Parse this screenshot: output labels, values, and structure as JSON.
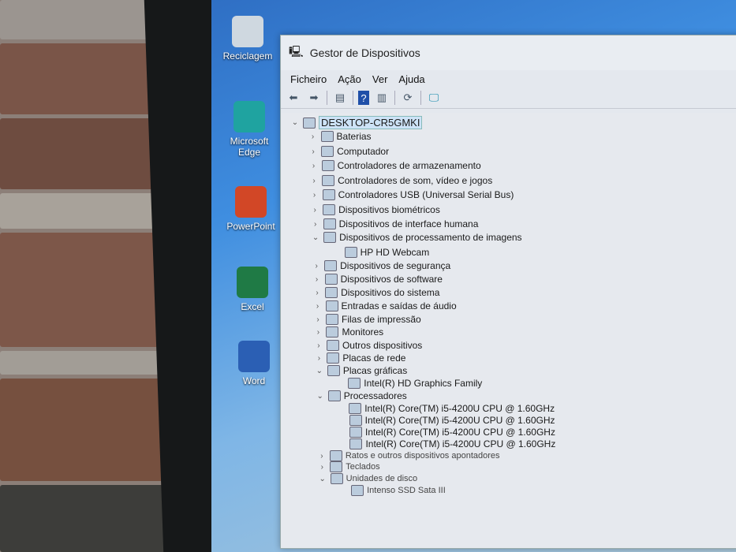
{
  "desktop": {
    "icons": [
      {
        "label": "Reciclagem",
        "icon": "recycle-bin-icon",
        "color": "#cfd8e0"
      },
      {
        "label": "Microsoft Edge",
        "icon": "edge-icon",
        "color": "#1fa3a0"
      },
      {
        "label": "PowerPoint",
        "icon": "powerpoint-icon",
        "color": "#d24726"
      },
      {
        "label": "Excel",
        "icon": "excel-icon",
        "color": "#1f7a45"
      },
      {
        "label": "Word",
        "icon": "word-icon",
        "color": "#2b5fb4"
      }
    ]
  },
  "window": {
    "title": "Gestor de Dispositivos",
    "menu": [
      "Ficheiro",
      "Ação",
      "Ver",
      "Ajuda"
    ],
    "toolbar": [
      "back-icon",
      "forward-icon",
      "properties-icon",
      "help-icon",
      "view-icon",
      "update-driver-icon",
      "scan-hardware-icon"
    ],
    "tree": [
      {
        "label": "DESKTOP-CR5GMKI",
        "level": 0,
        "expanded": true
      },
      {
        "label": "Baterias",
        "level": 1
      },
      {
        "label": "Computador",
        "level": 1
      },
      {
        "label": "Controladores de armazenamento",
        "level": 1
      },
      {
        "label": "Controladores de som, vídeo e jogos",
        "level": 1
      },
      {
        "label": "Controladores USB (Universal Serial Bus)",
        "level": 1
      },
      {
        "label": "Dispositivos biométricos",
        "level": 1
      },
      {
        "label": "Dispositivos de interface humana",
        "level": 1
      },
      {
        "label": "Dispositivos de processamento de imagens",
        "level": 1,
        "expanded": true
      },
      {
        "label": "HP HD Webcam",
        "level": 2
      },
      {
        "label": "Dispositivos de segurança",
        "level": 1
      },
      {
        "label": "Dispositivos de software",
        "level": 1
      },
      {
        "label": "Dispositivos do sistema",
        "level": 1
      },
      {
        "label": "Entradas e saídas de áudio",
        "level": 1
      },
      {
        "label": "Filas de impressão",
        "level": 1
      },
      {
        "label": "Monitores",
        "level": 1
      },
      {
        "label": "Outros dispositivos",
        "level": 1
      },
      {
        "label": "Placas de rede",
        "level": 1
      },
      {
        "label": "Placas gráficas",
        "level": 1,
        "expanded": true
      },
      {
        "label": "Intel(R) HD Graphics Family",
        "level": 2
      },
      {
        "label": "Processadores",
        "level": 1,
        "expanded": true
      },
      {
        "label": "Intel(R) Core(TM) i5-4200U CPU @ 1.60GHz",
        "level": 2
      },
      {
        "label": "Intel(R) Core(TM) i5-4200U CPU @ 1.60GHz",
        "level": 2
      },
      {
        "label": "Intel(R) Core(TM) i5-4200U CPU @ 1.60GHz",
        "level": 2
      },
      {
        "label": "Intel(R) Core(TM) i5-4200U CPU @ 1.60GHz",
        "level": 2
      },
      {
        "label": "Ratos e outros dispositivos apontadores",
        "level": 1
      },
      {
        "label": "Teclados",
        "level": 1
      },
      {
        "label": "Unidades de disco",
        "level": 1,
        "expanded": true
      },
      {
        "label": "Intenso SSD Sata III",
        "level": 2
      }
    ]
  }
}
